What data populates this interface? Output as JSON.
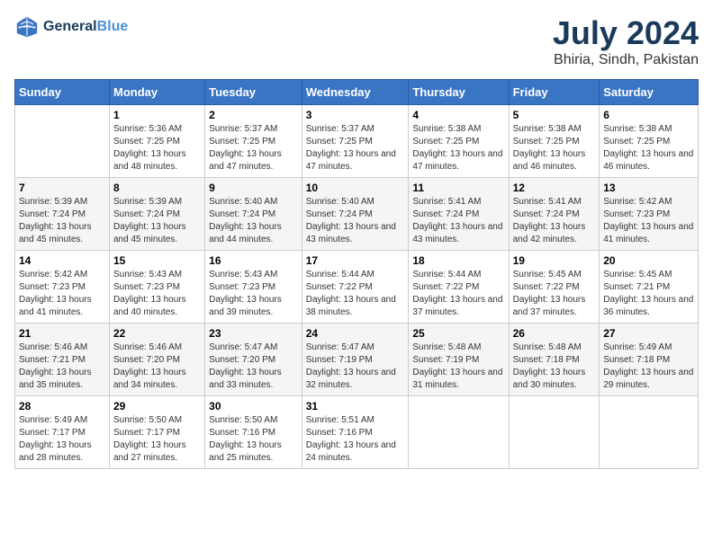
{
  "header": {
    "logo_line1": "General",
    "logo_line2": "Blue",
    "month": "July 2024",
    "location": "Bhiria, Sindh, Pakistan"
  },
  "weekdays": [
    "Sunday",
    "Monday",
    "Tuesday",
    "Wednesday",
    "Thursday",
    "Friday",
    "Saturday"
  ],
  "weeks": [
    [
      {
        "day": "",
        "sunrise": "",
        "sunset": "",
        "daylight": ""
      },
      {
        "day": "1",
        "sunrise": "5:36 AM",
        "sunset": "7:25 PM",
        "daylight": "13 hours and 48 minutes."
      },
      {
        "day": "2",
        "sunrise": "5:37 AM",
        "sunset": "7:25 PM",
        "daylight": "13 hours and 47 minutes."
      },
      {
        "day": "3",
        "sunrise": "5:37 AM",
        "sunset": "7:25 PM",
        "daylight": "13 hours and 47 minutes."
      },
      {
        "day": "4",
        "sunrise": "5:38 AM",
        "sunset": "7:25 PM",
        "daylight": "13 hours and 47 minutes."
      },
      {
        "day": "5",
        "sunrise": "5:38 AM",
        "sunset": "7:25 PM",
        "daylight": "13 hours and 46 minutes."
      },
      {
        "day": "6",
        "sunrise": "5:38 AM",
        "sunset": "7:25 PM",
        "daylight": "13 hours and 46 minutes."
      }
    ],
    [
      {
        "day": "7",
        "sunrise": "5:39 AM",
        "sunset": "7:24 PM",
        "daylight": "13 hours and 45 minutes."
      },
      {
        "day": "8",
        "sunrise": "5:39 AM",
        "sunset": "7:24 PM",
        "daylight": "13 hours and 45 minutes."
      },
      {
        "day": "9",
        "sunrise": "5:40 AM",
        "sunset": "7:24 PM",
        "daylight": "13 hours and 44 minutes."
      },
      {
        "day": "10",
        "sunrise": "5:40 AM",
        "sunset": "7:24 PM",
        "daylight": "13 hours and 43 minutes."
      },
      {
        "day": "11",
        "sunrise": "5:41 AM",
        "sunset": "7:24 PM",
        "daylight": "13 hours and 43 minutes."
      },
      {
        "day": "12",
        "sunrise": "5:41 AM",
        "sunset": "7:24 PM",
        "daylight": "13 hours and 42 minutes."
      },
      {
        "day": "13",
        "sunrise": "5:42 AM",
        "sunset": "7:23 PM",
        "daylight": "13 hours and 41 minutes."
      }
    ],
    [
      {
        "day": "14",
        "sunrise": "5:42 AM",
        "sunset": "7:23 PM",
        "daylight": "13 hours and 41 minutes."
      },
      {
        "day": "15",
        "sunrise": "5:43 AM",
        "sunset": "7:23 PM",
        "daylight": "13 hours and 40 minutes."
      },
      {
        "day": "16",
        "sunrise": "5:43 AM",
        "sunset": "7:23 PM",
        "daylight": "13 hours and 39 minutes."
      },
      {
        "day": "17",
        "sunrise": "5:44 AM",
        "sunset": "7:22 PM",
        "daylight": "13 hours and 38 minutes."
      },
      {
        "day": "18",
        "sunrise": "5:44 AM",
        "sunset": "7:22 PM",
        "daylight": "13 hours and 37 minutes."
      },
      {
        "day": "19",
        "sunrise": "5:45 AM",
        "sunset": "7:22 PM",
        "daylight": "13 hours and 37 minutes."
      },
      {
        "day": "20",
        "sunrise": "5:45 AM",
        "sunset": "7:21 PM",
        "daylight": "13 hours and 36 minutes."
      }
    ],
    [
      {
        "day": "21",
        "sunrise": "5:46 AM",
        "sunset": "7:21 PM",
        "daylight": "13 hours and 35 minutes."
      },
      {
        "day": "22",
        "sunrise": "5:46 AM",
        "sunset": "7:20 PM",
        "daylight": "13 hours and 34 minutes."
      },
      {
        "day": "23",
        "sunrise": "5:47 AM",
        "sunset": "7:20 PM",
        "daylight": "13 hours and 33 minutes."
      },
      {
        "day": "24",
        "sunrise": "5:47 AM",
        "sunset": "7:19 PM",
        "daylight": "13 hours and 32 minutes."
      },
      {
        "day": "25",
        "sunrise": "5:48 AM",
        "sunset": "7:19 PM",
        "daylight": "13 hours and 31 minutes."
      },
      {
        "day": "26",
        "sunrise": "5:48 AM",
        "sunset": "7:18 PM",
        "daylight": "13 hours and 30 minutes."
      },
      {
        "day": "27",
        "sunrise": "5:49 AM",
        "sunset": "7:18 PM",
        "daylight": "13 hours and 29 minutes."
      }
    ],
    [
      {
        "day": "28",
        "sunrise": "5:49 AM",
        "sunset": "7:17 PM",
        "daylight": "13 hours and 28 minutes."
      },
      {
        "day": "29",
        "sunrise": "5:50 AM",
        "sunset": "7:17 PM",
        "daylight": "13 hours and 27 minutes."
      },
      {
        "day": "30",
        "sunrise": "5:50 AM",
        "sunset": "7:16 PM",
        "daylight": "13 hours and 25 minutes."
      },
      {
        "day": "31",
        "sunrise": "5:51 AM",
        "sunset": "7:16 PM",
        "daylight": "13 hours and 24 minutes."
      },
      {
        "day": "",
        "sunrise": "",
        "sunset": "",
        "daylight": ""
      },
      {
        "day": "",
        "sunrise": "",
        "sunset": "",
        "daylight": ""
      },
      {
        "day": "",
        "sunrise": "",
        "sunset": "",
        "daylight": ""
      }
    ]
  ],
  "labels": {
    "sunrise_prefix": "Sunrise: ",
    "sunset_prefix": "Sunset: ",
    "daylight_prefix": "Daylight: "
  }
}
